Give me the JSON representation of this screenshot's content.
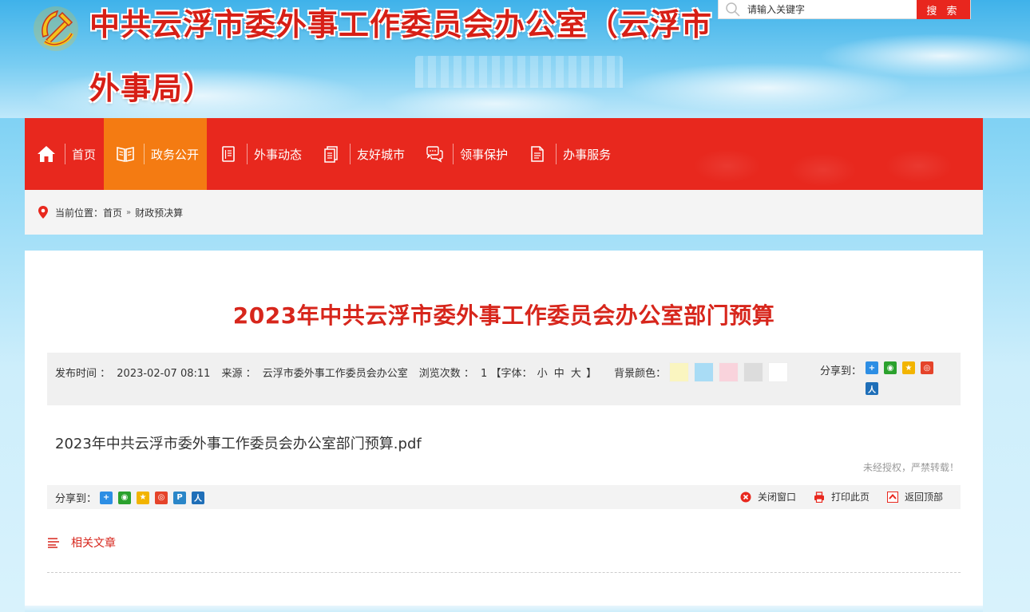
{
  "header": {
    "title_line1": "中共云浮市委外事工作委员会办公室（云浮市",
    "title_line2": "外事局）"
  },
  "search": {
    "placeholder": "请输入关键字",
    "button_label": "搜 索"
  },
  "nav": {
    "items": [
      {
        "label": "首页",
        "icon": "home-icon"
      },
      {
        "label": "政务公开",
        "icon": "book-icon",
        "active": true
      },
      {
        "label": "外事动态",
        "icon": "document-icon"
      },
      {
        "label": "友好城市",
        "icon": "pages-icon"
      },
      {
        "label": "领事保护",
        "icon": "chat-icon"
      },
      {
        "label": "办事服务",
        "icon": "file-icon"
      }
    ]
  },
  "breadcrumb": {
    "prefix": "当前位置：",
    "home": "首页",
    "separator": "»",
    "current": "财政预决算"
  },
  "article": {
    "title": "2023年中共云浮市委外事工作委员会办公室部门预算",
    "publish_label": "发布时间 ：",
    "publish_time": "2023-02-07 08:11",
    "source_label": "来源 ：",
    "source": "云浮市委外事工作委员会办公室",
    "views_label": "浏览次数 ：",
    "views": "1",
    "font_open": "【字体：",
    "font_small": "小",
    "font_medium": "中",
    "font_large": "大",
    "font_close": "】",
    "bg_label": "背景颜色：",
    "bg_colors": [
      "#faf5c0",
      "#a9dcf5",
      "#f9d3dc",
      "#dcdcdc",
      "#ffffff"
    ],
    "share_label": "分享到：",
    "attachment": "2023年中共云浮市委外事工作委员会办公室部门预算.pdf",
    "notice": "未经授权，严禁转载！"
  },
  "bottom_bar": {
    "share_label": "分享到：",
    "close_window": "关闭窗口",
    "print_page": "打印此页",
    "back_to_top": "返回顶部"
  },
  "related": {
    "label": "相关文章"
  },
  "colors": {
    "primary_red": "#e8281e",
    "active_orange": "#f47b12",
    "title_red": "#d7261c"
  }
}
